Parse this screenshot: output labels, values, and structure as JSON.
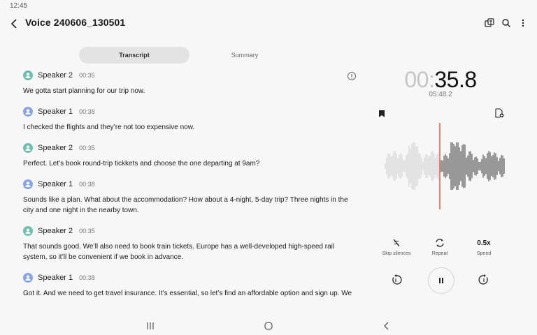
{
  "status": {
    "time": "12:45"
  },
  "header": {
    "title": "Voice 240606_130501"
  },
  "tabs": [
    {
      "label": "Transcript",
      "active": true
    },
    {
      "label": "Summary",
      "active": false
    }
  ],
  "colors": {
    "speaker1": "#8aa6e0",
    "speaker2": "#6fbfae",
    "playhead": "#e0473d"
  },
  "transcript": [
    {
      "speaker": "Speaker 2",
      "time": "00:35",
      "text": "We gotta start planning for our trip now."
    },
    {
      "speaker": "Speaker 1",
      "time": "00:38",
      "text": "I checked the flights and they’re not too expensive now."
    },
    {
      "speaker": "Speaker 2",
      "time": "00:35",
      "text": "Perfect. Let’s book round-trip tickkets and choose the one departing at 9am?"
    },
    {
      "speaker": "Speaker 1",
      "time": "00:38",
      "text": "Sounds like a plan. What about the accommodation? How about a 4-night, 5-day trip? Three nights in the city and one night in the nearby town."
    },
    {
      "speaker": "Speaker 2",
      "time": "00:35",
      "text": "That sounds good. We’ll also need to book train tickets. Europe has a well-developed high-speed rail system, so it’ll be convenient if we book in advance."
    },
    {
      "speaker": "Speaker 1",
      "time": "00:38",
      "text": "Got it. And we need to get travel insurance. It’s essential, so let’s find an affordable option and sign up. We should also bring mosquito repellent and portable fans. The humidity might be high, so there could"
    }
  ],
  "player": {
    "elapsed_dim": "00:",
    "elapsed_bright": "35.8",
    "total": "05:48.2",
    "controls": {
      "skip_silences": "Skip silences",
      "repeat": "Repeat",
      "speed_value": "0.5x",
      "speed_label": "Speed"
    }
  }
}
